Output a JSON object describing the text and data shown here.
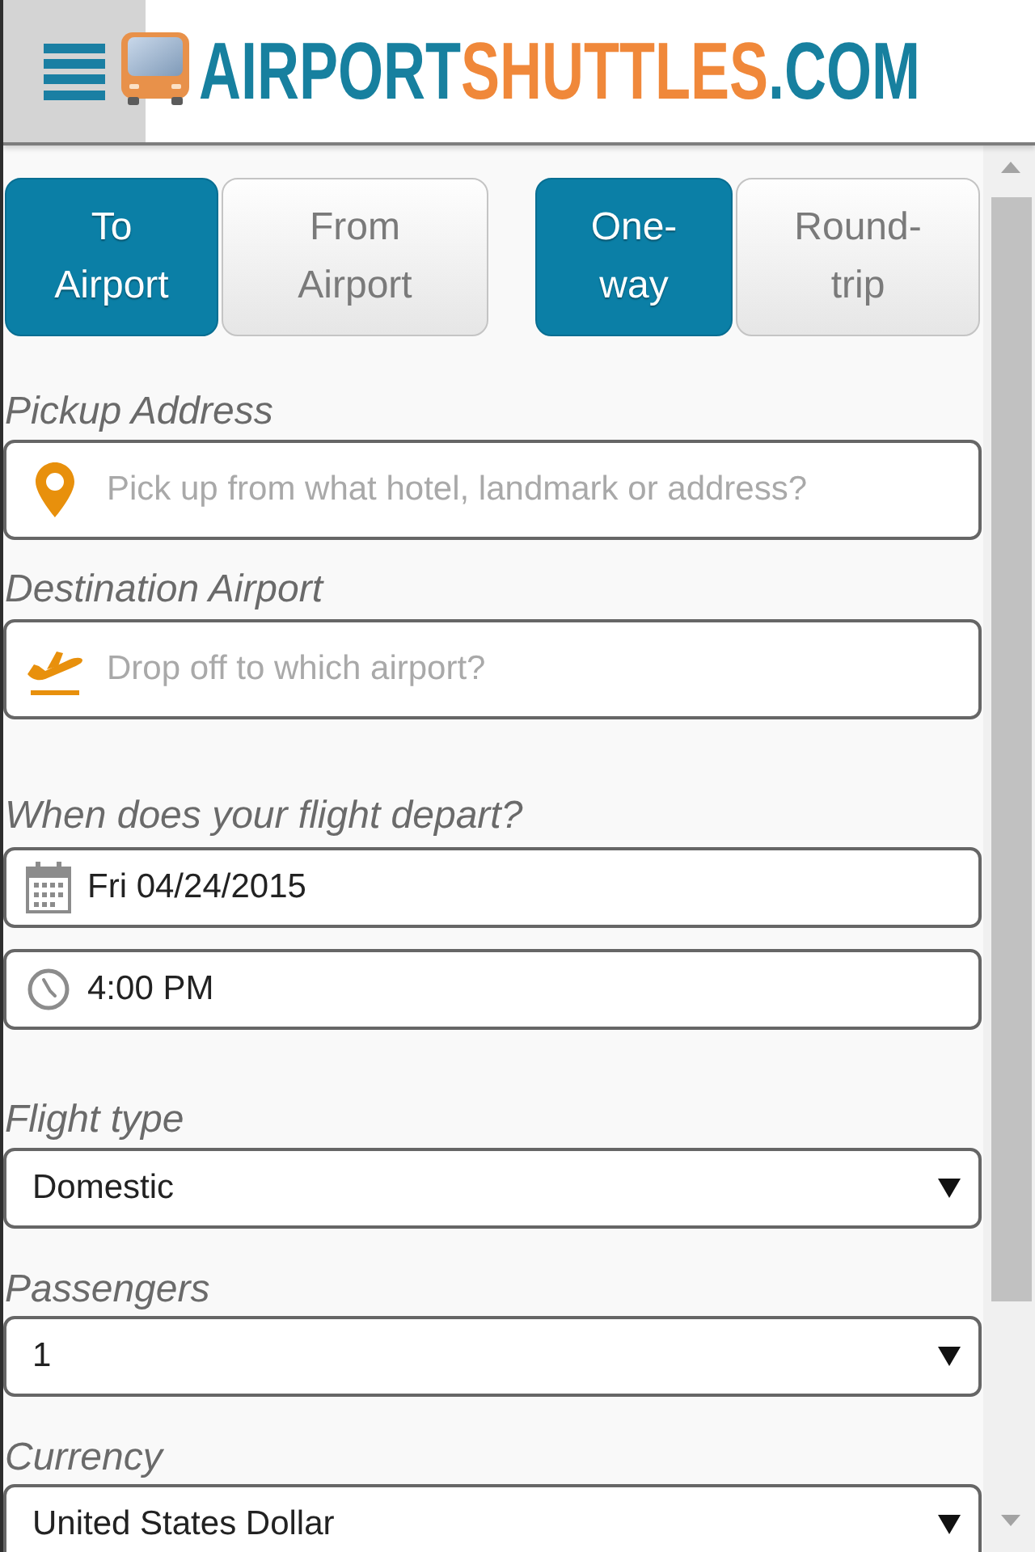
{
  "header": {
    "logo": {
      "words": [
        "AIRPORT",
        "SHUTTLES",
        ".COM"
      ]
    }
  },
  "trip_direction": [
    {
      "label": "To Airport",
      "selected": true
    },
    {
      "label": "From Airport",
      "selected": false
    }
  ],
  "trip_type": [
    {
      "label": "One-way",
      "selected": true
    },
    {
      "label": "Round-trip",
      "selected": false
    }
  ],
  "pickup_address": {
    "label": "Pickup Address",
    "placeholder": "Pick up from what hotel, landmark or address?"
  },
  "destination_airport": {
    "label": "Destination Airport",
    "placeholder": "Drop off to which airport?"
  },
  "departure": {
    "label": "When does your flight depart?",
    "date": "Fri 04/24/2015",
    "time": "4:00 PM"
  },
  "dropdowns": [
    {
      "label": "Flight type",
      "value": "Domestic"
    },
    {
      "label": "Passengers",
      "value": "1"
    },
    {
      "label": "Currency",
      "value": "United States Dollar"
    }
  ]
}
